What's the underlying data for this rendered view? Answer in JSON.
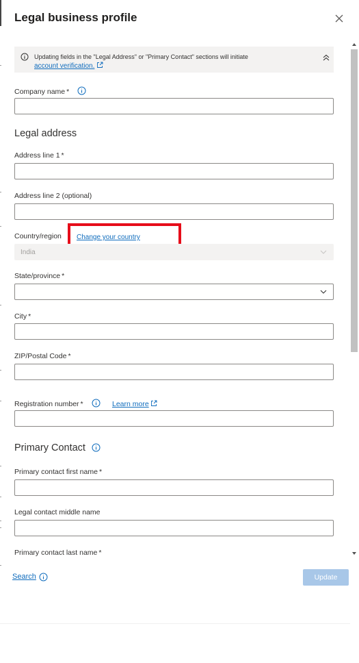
{
  "header": {
    "title": "Legal business profile"
  },
  "banner": {
    "text": "Updating fields in the \"Legal Address\" or \"Primary Contact\" sections will initiate",
    "link": "account verification."
  },
  "fields": {
    "company_name": {
      "label": "Company name",
      "required_mark": "*",
      "value": ""
    },
    "legal_address_title": "Legal address",
    "address1": {
      "label": "Address line 1",
      "required_mark": "*",
      "value": ""
    },
    "address2": {
      "label": "Address line 2 (optional)",
      "value": ""
    },
    "country": {
      "label": "Country/region",
      "link": "Change your country",
      "value": "India"
    },
    "state": {
      "label": "State/province",
      "required_mark": "*",
      "value": ""
    },
    "city": {
      "label": "City",
      "required_mark": "*",
      "value": ""
    },
    "zip": {
      "label": "ZIP/Postal Code",
      "required_mark": "*",
      "value": ""
    },
    "registration": {
      "label": "Registration number",
      "required_mark": "*",
      "link": "Learn more",
      "value": ""
    },
    "primary_contact_title": "Primary Contact",
    "first_name": {
      "label": "Primary contact first name",
      "required_mark": "*",
      "value": ""
    },
    "middle_name": {
      "label": "Legal contact middle name",
      "value": ""
    },
    "last_name": {
      "label": "Primary contact last name",
      "required_mark": "*"
    }
  },
  "footer": {
    "search": "Search",
    "update": "Update"
  },
  "colors": {
    "link": "#0f6cbd",
    "highlight": "#e60d1a",
    "update_disabled": "#a8c7e8",
    "banner_bg": "#f3f2f1"
  },
  "icons": [
    "close-icon",
    "info-icon",
    "chevron-double-up-icon",
    "external-link-icon",
    "chevron-down-icon",
    "scroll-up-icon",
    "scroll-down-icon"
  ]
}
